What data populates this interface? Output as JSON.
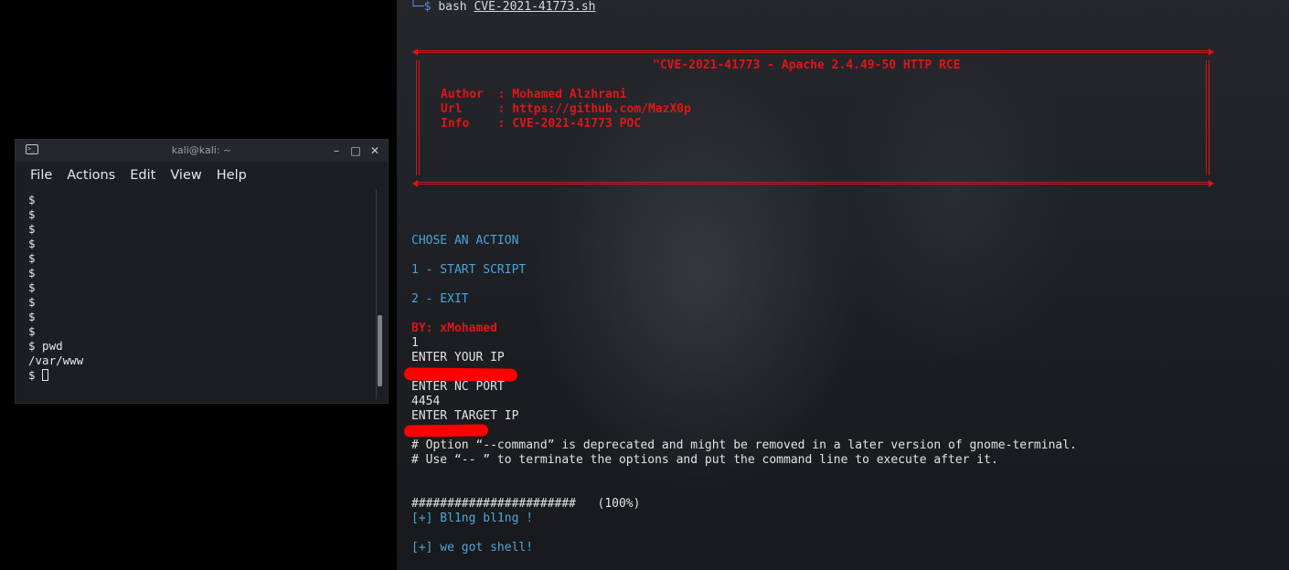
{
  "left_terminal": {
    "title": "kali@kali: ~",
    "menu": [
      "File",
      "Actions",
      "Edit",
      "View",
      "Help"
    ],
    "lines": [
      "$",
      "$",
      "$",
      "$",
      "$",
      "$",
      "$",
      "$",
      "$",
      "$",
      "$ pwd",
      "/var/www"
    ],
    "prompt": "$ "
  },
  "right_terminal": {
    "prompt_corner": "└─",
    "prompt_symbol": "$",
    "command": "bash",
    "command_arg": "CVE-2021-41773.sh",
    "banner": {
      "title": "\"CVE-2021-41773 - Apache 2.4.49-50 HTTP RCE",
      "author": "Author  : Mohamed Alzhrani",
      "url": "Url     : https://github.com/MazX0p",
      "info": "Info    : CVE-2021-41773 POC"
    },
    "menu": {
      "header": "CHOSE AN ACTION",
      "option1": "1 - START SCRIPT",
      "option2": "2 - EXIT"
    },
    "by_line": "BY: xMohamed",
    "input_1": "1",
    "prompt_ip": "ENTER YOUR IP",
    "prompt_port": "ENTER NC PORT",
    "port_value": "4454",
    "prompt_target": "ENTER TARGET IP",
    "warning_1": "# Option “--command” is deprecated and might be removed in a later version of gnome-terminal.",
    "warning_2": "# Use “-- ” to terminate the options and put the command line to execute after it.",
    "progress": "#######################   (100%)",
    "result_1": "[+] Bl1ng bl1ng !",
    "result_2": "[+] we got shell!"
  },
  "colors": {
    "banner_red": "#d01818",
    "menu_blue": "#4aa3d9",
    "redaction": "#ff0000"
  }
}
